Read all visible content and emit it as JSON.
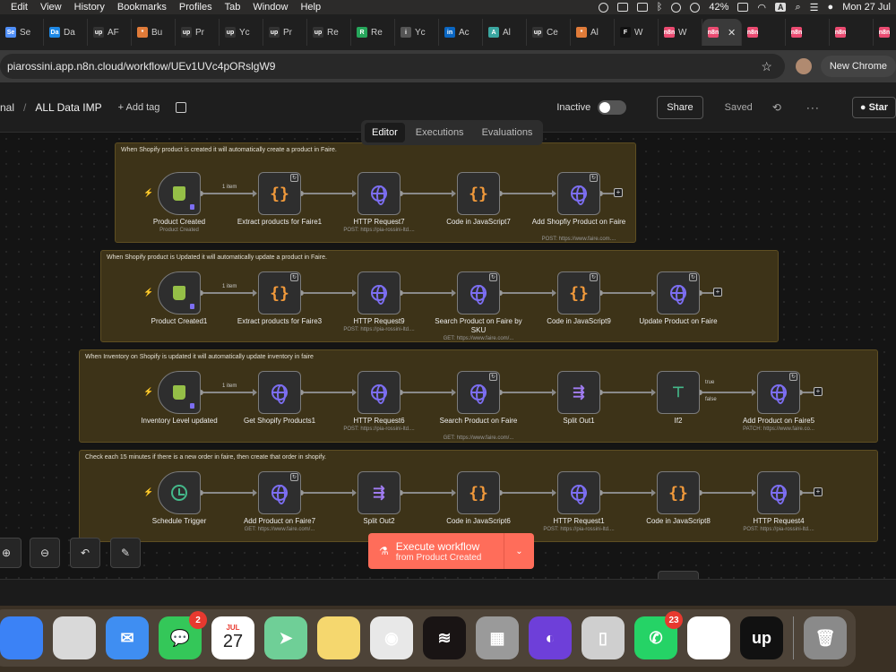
{
  "menubar": {
    "items": [
      "Edit",
      "View",
      "History",
      "Bookmarks",
      "Profiles",
      "Tab",
      "Window",
      "Help"
    ],
    "battery": "42%",
    "input_source": "A",
    "clock": "Mon 27 Jul"
  },
  "tabs": [
    {
      "fav": "Se",
      "label": "Se",
      "color": "#4f8ef7"
    },
    {
      "fav": "Da",
      "label": "Da",
      "color": "#1e88e5"
    },
    {
      "fav": "up",
      "label": "AF",
      "color": "#333333"
    },
    {
      "fav": "*",
      "label": "Bu",
      "color": "#e07b39"
    },
    {
      "fav": "up",
      "label": "Pr",
      "color": "#333333"
    },
    {
      "fav": "up",
      "label": "Yc",
      "color": "#333333"
    },
    {
      "fav": "up",
      "label": "Pr",
      "color": "#333333"
    },
    {
      "fav": "up",
      "label": "Re",
      "color": "#333333"
    },
    {
      "fav": "R",
      "label": "Re",
      "color": "#26a65b"
    },
    {
      "fav": "i",
      "label": "Yc",
      "color": "#555555"
    },
    {
      "fav": "in",
      "label": "Ac",
      "color": "#0a66c2"
    },
    {
      "fav": "A",
      "label": "Al",
      "color": "#3aa6a0"
    },
    {
      "fav": "up",
      "label": "Ce",
      "color": "#333333"
    },
    {
      "fav": "*",
      "label": "Al",
      "color": "#e07b39"
    },
    {
      "fav": "F",
      "label": "W",
      "color": "#111111"
    },
    {
      "fav": "n8n",
      "label": "W",
      "color": "#ea4b71"
    },
    {
      "fav": "n8n",
      "label": "",
      "color": "#ea4b71",
      "active": true
    },
    {
      "fav": "n8n",
      "label": "",
      "color": "#ea4b71"
    },
    {
      "fav": "n8n",
      "label": "",
      "color": "#ea4b71"
    },
    {
      "fav": "n8n",
      "label": "",
      "color": "#ea4b71"
    },
    {
      "fav": "n8n",
      "label": "",
      "color": "#ea4b71"
    },
    {
      "fav": "n8n",
      "label": "",
      "color": "#ea4b71"
    }
  ],
  "address": {
    "url": "piarossini.app.n8n.cloud/workflow/UEv1UVc4pORslgW9",
    "new_chrome": "New Chrome"
  },
  "header": {
    "crumb_prev": "nal",
    "title": "ALL Data IMP",
    "add_tag": "+ Add tag",
    "inactive": "Inactive",
    "share": "Share",
    "saved": "Saved",
    "star": "Star"
  },
  "view_tabs": [
    "Editor",
    "Executions",
    "Evaluations"
  ],
  "groups": [
    {
      "note": "When Shopify product is created it will automatically create a product in Faire."
    },
    {
      "note": "When Shopify product is Updated it will automatically update a product in Faire."
    },
    {
      "note": "When Inventory on Shopify is updated it will automatically update inventory in faire"
    },
    {
      "note": "Check each 15 minutes if there is a new order in faire, then create that order in shopify."
    }
  ],
  "rows": [
    [
      {
        "label": "Product Created",
        "sub": "Product Created",
        "icon": "shop",
        "trigger": true
      },
      {
        "label": "Extract products for Faire1",
        "sub": "",
        "icon": "code",
        "loop": true
      },
      {
        "label": "HTTP Request7",
        "sub": "POST: https://pia-rossini-ltd....",
        "icon": "globe"
      },
      {
        "label": "Code in JavaScript7",
        "sub": "",
        "icon": "code"
      },
      {
        "label": "Add Shopfiy Product on Faire",
        "sub": "POST: https://www.faire.com....",
        "icon": "globe",
        "loop": true
      }
    ],
    [
      {
        "label": "Product Created1",
        "sub": "",
        "icon": "shop",
        "trigger": true
      },
      {
        "label": "Extract products for Faire3",
        "sub": "",
        "icon": "code",
        "loop": true
      },
      {
        "label": "HTTP Request9",
        "sub": "POST: https://pia-rossini-ltd....",
        "icon": "globe"
      },
      {
        "label": "Search Product on Faire by SKU",
        "sub": "GET: https://www.faire.com/...",
        "icon": "globe",
        "loop": true
      },
      {
        "label": "Code in JavaScript9",
        "sub": "",
        "icon": "code",
        "loop": true
      },
      {
        "label": "Update Product on Faire",
        "sub": "",
        "icon": "globe",
        "loop": true
      }
    ],
    [
      {
        "label": "Inventory Level updated",
        "sub": "",
        "icon": "shop",
        "trigger": true
      },
      {
        "label": "Get Shopify Products1",
        "sub": "",
        "icon": "globe"
      },
      {
        "label": "HTTP Request6",
        "sub": "POST: https://pia-rossini-ltd....",
        "icon": "globe"
      },
      {
        "label": "Search Product on Faire",
        "sub": "GET: https://www.faire.com/...",
        "icon": "globe",
        "loop": true
      },
      {
        "label": "Split Out1",
        "sub": "",
        "icon": "split"
      },
      {
        "label": "If2",
        "sub": "",
        "icon": "iff"
      },
      {
        "label": "Add Product on Faire5",
        "sub": "PATCH: https://www.faire.co...",
        "icon": "globe",
        "loop": true
      }
    ],
    [
      {
        "label": "Schedule Trigger",
        "sub": "",
        "icon": "clock",
        "trigger": true
      },
      {
        "label": "Add Product on Faire7",
        "sub": "GET: https://www.faire.com/...",
        "icon": "globe",
        "loop": true
      },
      {
        "label": "Split Out2",
        "sub": "",
        "icon": "split"
      },
      {
        "label": "Code in JavaScript6",
        "sub": "",
        "icon": "code"
      },
      {
        "label": "HTTP Request1",
        "sub": "POST: https://pia-rossini-ltd....",
        "icon": "globe"
      },
      {
        "label": "Code in JavaScript8",
        "sub": "",
        "icon": "code"
      },
      {
        "label": "HTTP Request4",
        "sub": "POST: https://pia-rossini-ltd....",
        "icon": "globe"
      }
    ]
  ],
  "item_label": "1 item",
  "if_labels": {
    "true": "true",
    "false": "false"
  },
  "execute": {
    "line1": "Execute workflow",
    "line2": "from Product Created"
  },
  "dock": [
    {
      "name": "finder",
      "color": "#3b82f6",
      "glyph": ""
    },
    {
      "name": "launchpad",
      "color": "#d9d9d9",
      "glyph": ""
    },
    {
      "name": "mail",
      "color": "#3f8ef2",
      "glyph": "✉"
    },
    {
      "name": "messages",
      "color": "#34c759",
      "glyph": "💬",
      "badge": "2"
    },
    {
      "name": "calendar",
      "color": "#ffffff",
      "glyph": "27",
      "month": "JUL"
    },
    {
      "name": "maps",
      "color": "#6fcf97",
      "glyph": "➤"
    },
    {
      "name": "notes",
      "color": "#f5d76e",
      "glyph": ""
    },
    {
      "name": "chrome",
      "color": "#e8e8e8",
      "glyph": "◉"
    },
    {
      "name": "spotify",
      "color": "#191414",
      "glyph": "≋"
    },
    {
      "name": "calculator",
      "color": "#9a9a9a",
      "glyph": "▦"
    },
    {
      "name": "firefox",
      "color": "#6e3fd9",
      "glyph": "◐"
    },
    {
      "name": "iphone-mirroring",
      "color": "#cfcfcf",
      "glyph": "▯"
    },
    {
      "name": "whatsapp",
      "color": "#25d366",
      "glyph": "✆",
      "badge": "23"
    },
    {
      "name": "slack",
      "color": "#ffffff",
      "glyph": "✱"
    },
    {
      "name": "upwork",
      "color": "#111111",
      "glyph": "up"
    },
    {
      "name": "trash",
      "color": "#8a8a8a",
      "glyph": "🗑"
    }
  ]
}
